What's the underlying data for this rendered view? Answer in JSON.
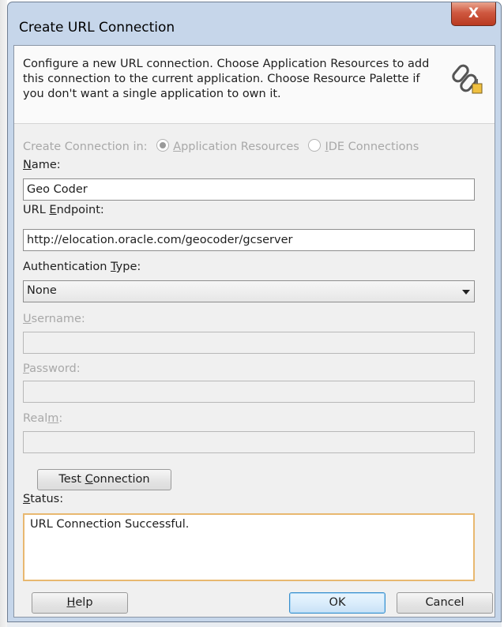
{
  "window": {
    "title": "Create URL Connection",
    "close_label": "X"
  },
  "header": {
    "description": "Configure a new URL connection.  Choose Application Resources to add this connection to the current application. Choose Resource Palette if you don't want a single application to own it.",
    "icon": "link-chain-icon"
  },
  "create_in": {
    "label": "Create Connection in:",
    "option1": "Application Resources",
    "option2": "IDE Connections",
    "selected": "Application Resources"
  },
  "name": {
    "label": "Name:",
    "value": "Geo Coder"
  },
  "url": {
    "label": "URL Endpoint:",
    "value": "http://elocation.oracle.com/geocoder/gcserver"
  },
  "auth": {
    "label": "Authentication Type:",
    "value": "None"
  },
  "username": {
    "label": "Username:",
    "value": ""
  },
  "password": {
    "label": "Password:",
    "value": ""
  },
  "realm": {
    "label": "Realm:",
    "value": ""
  },
  "test_button": "Test Connection",
  "status": {
    "label": "Status:",
    "text": "URL Connection Successful."
  },
  "buttons": {
    "help": "Help",
    "ok": "OK",
    "cancel": "Cancel"
  },
  "colors": {
    "title_bg": "#c6d6ea",
    "status_border": "#e8b870",
    "close_red": "#c94d34"
  }
}
